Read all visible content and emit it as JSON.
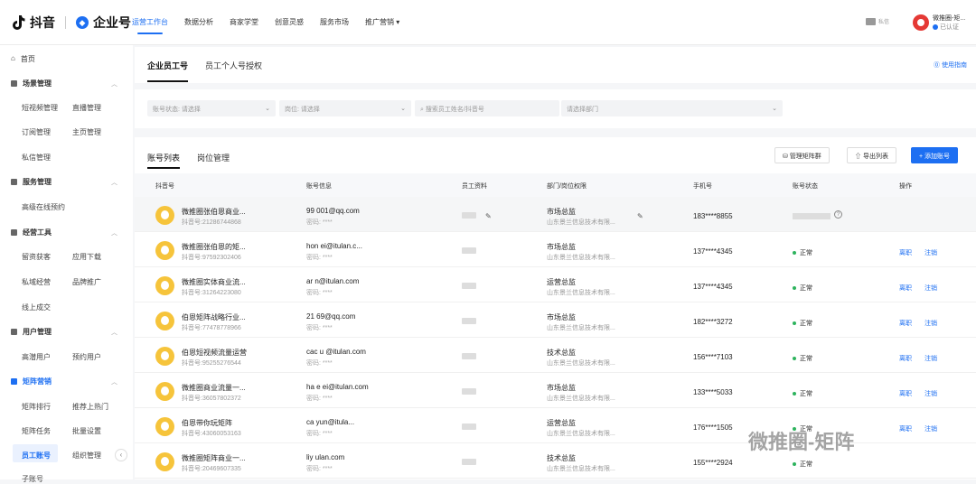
{
  "brand": {
    "douyin": "抖音",
    "enterprise": "企业号"
  },
  "top_nav": [
    "运营工作台",
    "数据分析",
    "商家学堂",
    "创意灵感",
    "服务市场",
    "推广营销"
  ],
  "top_nav_dropdown": "▾",
  "message_label": "私信",
  "user": {
    "name": "微推圈-矩...",
    "status": "已认证"
  },
  "sidebar": {
    "home": "首页",
    "groups": [
      {
        "title": "场景管理",
        "items": [
          "短视频管理",
          "直播管理",
          "订阅管理",
          "主页管理",
          "私信管理"
        ]
      },
      {
        "title": "服务管理",
        "items": [
          "高级在线预约"
        ]
      },
      {
        "title": "经营工具",
        "items": [
          "留资获客",
          "应用下载",
          "私域经营",
          "品牌推广",
          "线上成交"
        ]
      },
      {
        "title": "用户管理",
        "items": [
          "高潜用户",
          "预约用户"
        ]
      },
      {
        "title": "矩阵营销",
        "items": [
          "矩阵排行",
          "推荐上热门",
          "矩阵任务",
          "批量设置",
          "员工账号",
          "组织管理",
          "子账号"
        ]
      }
    ]
  },
  "page_tabs": [
    "企业员工号",
    "员工个人号授权"
  ],
  "guide_link": "⓪ 使用指南",
  "filters": {
    "status": "账号状态: 请选择",
    "position": "岗位: 请选择",
    "search": "搜索员工姓名/抖音号",
    "department": "请选择部门"
  },
  "list_tabs": [
    "账号列表",
    "岗位管理"
  ],
  "buttons": {
    "matrix_group": "管理矩阵群",
    "export": "导出列表",
    "add": "+ 添加账号"
  },
  "columns": [
    "抖音号",
    "账号信息",
    "员工资料",
    "部门/岗位权限",
    "手机号",
    "账号状态",
    "操作"
  ],
  "rows": [
    {
      "name": "微推圈张伯恩商业...",
      "dy": "抖音号:21286744868",
      "email": "99  001@qq.com",
      "pwd": "密码: ****",
      "dept": "市场总监",
      "company": "山东景兰信息技术有限...",
      "phone": "183****8855",
      "status": "",
      "actions": []
    },
    {
      "name": "微推圈张伯恩的矩...",
      "dy": "抖音号:97592302406",
      "email": "hon  ei@itulan.c...",
      "pwd": "密码: ****",
      "dept": "市场总监",
      "company": "山东景兰信息技术有限...",
      "phone": "137****4345",
      "status": "正常",
      "actions": [
        "离职",
        "注销"
      ]
    },
    {
      "name": "微推圈实体商业流...",
      "dy": "抖音号:31264223080",
      "email": "  ar  n@itulan.com",
      "pwd": "密码: ****",
      "dept": "运营总监",
      "company": "山东景兰信息技术有限...",
      "phone": "137****4345",
      "status": "正常",
      "actions": [
        "离职",
        "注销"
      ]
    },
    {
      "name": "伯恩矩阵战略行业...",
      "dy": "抖音号:77478778966",
      "email": "21  69@qq.com",
      "pwd": "密码: ****",
      "dept": "市场总监",
      "company": "山东景兰信息技术有限...",
      "phone": "182****3272",
      "status": "正常",
      "actions": [
        "离职",
        "注销"
      ]
    },
    {
      "name": "伯恩短视频流量运营",
      "dy": "抖音号:95255276544",
      "email": "cac  u  @itulan.com",
      "pwd": "密码: ****",
      "dept": "技术总监",
      "company": "山东景兰信息技术有限...",
      "phone": "156****7103",
      "status": "正常",
      "actions": [
        "离职",
        "注销"
      ]
    },
    {
      "name": "微推圈商业流量一...",
      "dy": "抖音号:36057802372",
      "email": "ha  e  ei@itulan.com",
      "pwd": "密码: ****",
      "dept": "市场总监",
      "company": "山东景兰信息技术有限...",
      "phone": "133****5033",
      "status": "正常",
      "actions": [
        "离职",
        "注销"
      ]
    },
    {
      "name": "伯恩带你玩矩阵",
      "dy": "抖音号:43060053163",
      "email": "ca  yun@itula...",
      "pwd": "密码: ****",
      "dept": "运营总监",
      "company": "山东景兰信息技术有限...",
      "phone": "176****1505",
      "status": "正常",
      "actions": [
        "离职",
        "注销"
      ]
    },
    {
      "name": "微推圈矩阵商业一...",
      "dy": "抖音号:20469607335",
      "email": "liy  ulan.com",
      "pwd": "密码: ****",
      "dept": "技术总监",
      "company": "山东景兰信息技术有限...",
      "phone": "155****2924",
      "status": "正常",
      "actions": []
    }
  ],
  "watermark": "微推圈-矩阵"
}
